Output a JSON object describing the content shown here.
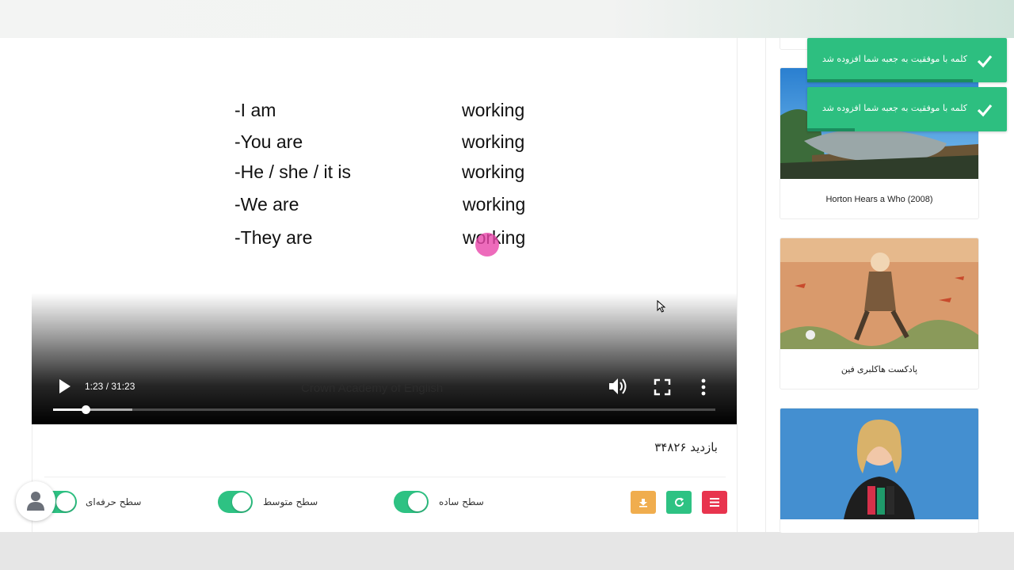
{
  "video": {
    "slide_rows": [
      {
        "subject": "-I am",
        "verb": "working"
      },
      {
        "subject": "-You are",
        "verb": "working"
      },
      {
        "subject": "-He / she / it is",
        "verb": "working"
      },
      {
        "subject": "-We are",
        "verb": "working"
      },
      {
        "subject": "-They are",
        "verb": "working"
      }
    ],
    "time_display": "1:23 / 31:23",
    "watermark": "Crown Academy of English",
    "progress": {
      "played_fraction": 0.049,
      "buffered_fraction": 0.12
    },
    "icons": {
      "play": "play-icon",
      "volume": "volume-icon",
      "fullscreen": "fullscreen-icon",
      "more": "more-vertical-icon"
    }
  },
  "views_label": "بازدید ۳۴۸۲۶",
  "levels": [
    {
      "label": "سطح ساده",
      "enabled": true
    },
    {
      "label": "سطح متوسط",
      "enabled": true
    },
    {
      "label": "سطح حرفه‌ای",
      "enabled": true
    }
  ],
  "action_buttons": [
    {
      "icon": "download-icon",
      "color": "#f0ad4e"
    },
    {
      "icon": "refresh-icon",
      "color": "#2ec283"
    },
    {
      "icon": "menu-icon",
      "color": "#e8344e"
    }
  ],
  "sidebar": {
    "cards": [
      {
        "title": "Horton Hears a Who (2008)"
      },
      {
        "title": "پادکست هاکلبری فین"
      },
      {
        "title": ""
      }
    ]
  },
  "toasts": [
    {
      "message": "کلمه با موفقیت به جعبه شما افزوده شد",
      "progress_fraction": 0.83
    },
    {
      "message": "کلمه با موفقیت به جعبه شما افزوده شد",
      "progress_fraction": 0.24
    }
  ],
  "colors": {
    "accent_green": "#2ec283",
    "toast_green": "#2dbf80",
    "danger_red": "#e8344e",
    "warning_orange": "#f0ad4e"
  }
}
